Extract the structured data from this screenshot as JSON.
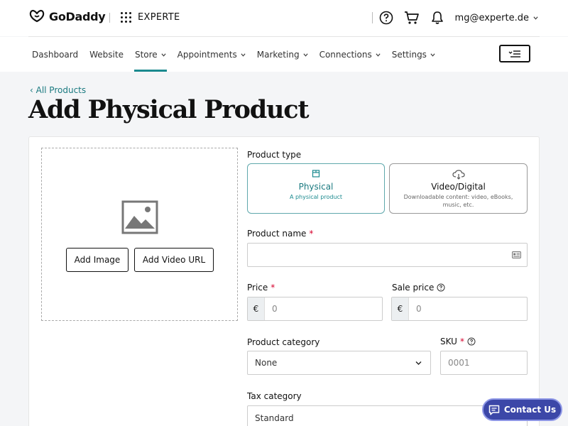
{
  "header": {
    "logo_text": "GoDaddy",
    "apps_label": "EXPERTE",
    "user_email": "mg@experte.de",
    "icons": [
      "help-icon",
      "cart-icon",
      "bell-icon"
    ]
  },
  "nav": {
    "items": [
      {
        "label": "Dashboard",
        "dropdown": false
      },
      {
        "label": "Website",
        "dropdown": false
      },
      {
        "label": "Store",
        "dropdown": true,
        "active": true
      },
      {
        "label": "Appointments",
        "dropdown": true
      },
      {
        "label": "Marketing",
        "dropdown": true
      },
      {
        "label": "Connections",
        "dropdown": true
      },
      {
        "label": "Settings",
        "dropdown": true
      }
    ]
  },
  "page": {
    "back_link": "‹ All Products",
    "title": "Add Physical Product"
  },
  "media": {
    "add_image": "Add Image",
    "add_video_url": "Add Video URL"
  },
  "form": {
    "product_type_label": "Product type",
    "types": [
      {
        "title": "Physical",
        "desc": "A physical product",
        "selected": true
      },
      {
        "title": "Video/Digital",
        "desc": "Downloadable content: video, eBooks, music, etc.",
        "selected": false
      }
    ],
    "product_name_label": "Product name",
    "product_name_value": "",
    "price_label": "Price",
    "price_currency": "€",
    "price_placeholder": "0",
    "sale_price_label": "Sale price",
    "sale_currency": "€",
    "sale_placeholder": "0",
    "category_label": "Product category",
    "category_value": "None",
    "sku_label": "SKU",
    "sku_placeholder": "0001",
    "tax_label": "Tax category",
    "tax_value": "Standard",
    "required_mark": "*"
  },
  "contact": {
    "label": "Contact Us"
  },
  "colors": {
    "accent": "#1b8a8f",
    "contact_bg": "#3c47a8",
    "required": "#d6002c"
  }
}
